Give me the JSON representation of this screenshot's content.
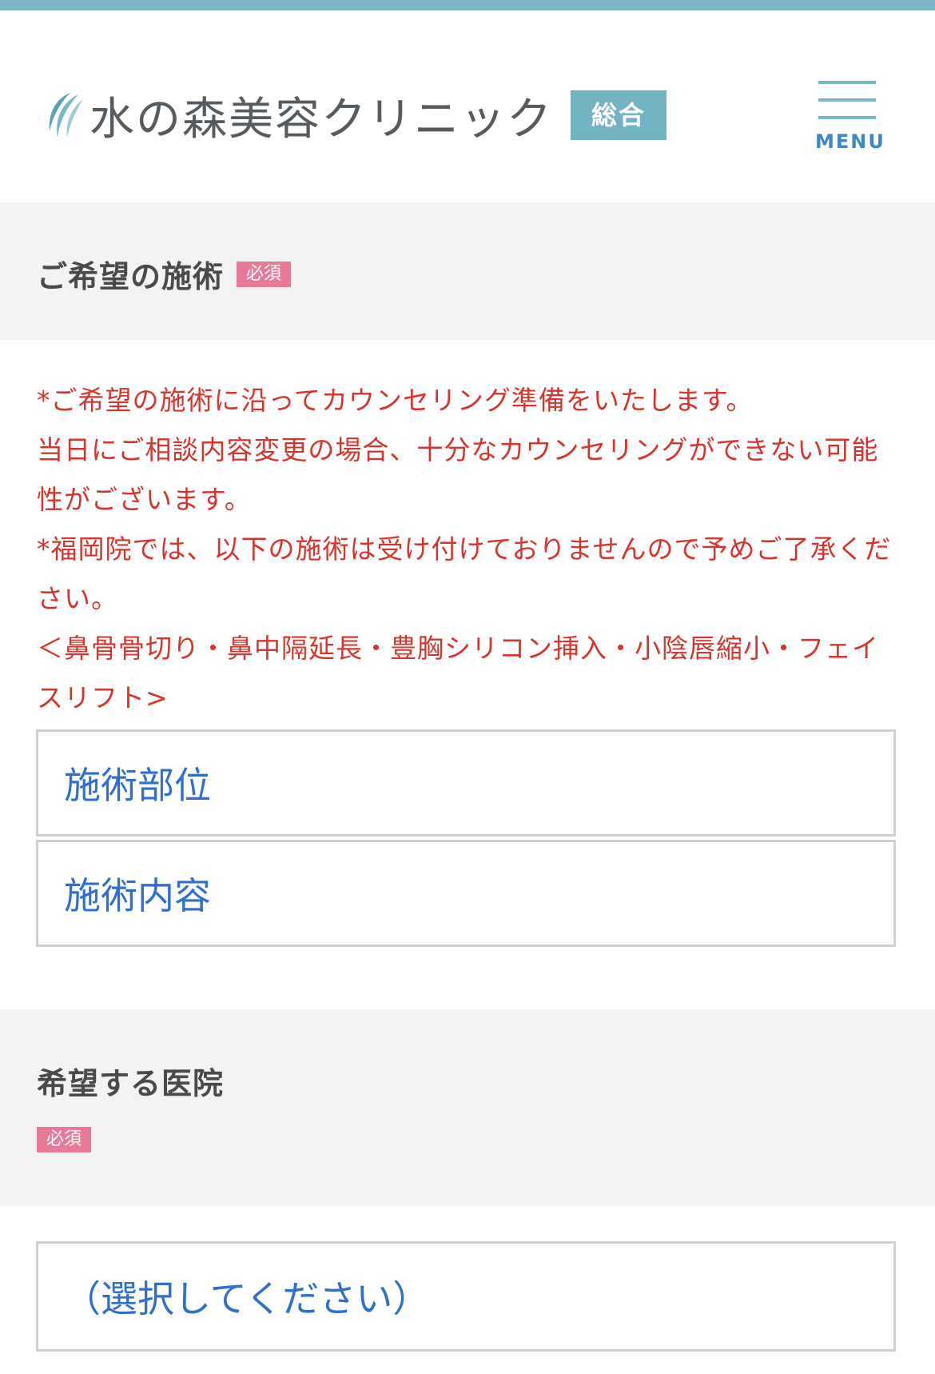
{
  "header": {
    "logo_text": "水の森美容クリニック",
    "badge": "総合",
    "menu_label": "MENU"
  },
  "treatment_section": {
    "title": "ご希望の施術",
    "required_badge": "必須",
    "notes": [
      "*ご希望の施術に沿ってカウンセリング準備をいたします。",
      "当日にご相談内容変更の場合、十分なカウンセリングができない可能性がございます。",
      "*福岡院では、以下の施術は受け付けておりませんので予めご了承ください。",
      "＜鼻骨骨切り・鼻中隔延長・豊胸シリコン挿入・小陰唇縮小・フェイスリフト>"
    ],
    "select_area_placeholder": "施術部位",
    "select_content_placeholder": "施術内容"
  },
  "clinic_section": {
    "title": "希望する医院",
    "required_badge": "必須",
    "select_placeholder": "（選択してください）"
  },
  "colors": {
    "accent": "#7ab8c8",
    "badge_bg": "#72b4c4",
    "required_bg": "#e87a97",
    "note_text": "#d9342b",
    "select_text": "#2f6fd0",
    "section_bg": "#f3f3f3"
  }
}
